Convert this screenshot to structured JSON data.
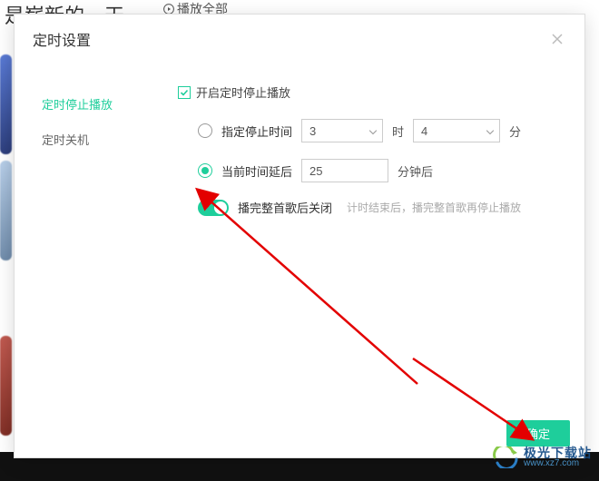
{
  "background": {
    "headline": "是崭新的一天~",
    "play_all": "播放全部"
  },
  "modal": {
    "title": "定时设置",
    "sidebar": {
      "items": [
        {
          "label": "定时停止播放"
        },
        {
          "label": "定时关机"
        }
      ]
    },
    "enable_label": "开启定时停止播放",
    "option_specify": {
      "label": "指定停止时间",
      "hour_value": "3",
      "hour_unit": "时",
      "min_value": "4",
      "min_unit": "分"
    },
    "option_delay": {
      "label": "当前时间延后",
      "value": "25",
      "unit": "分钟后"
    },
    "toggle": {
      "label": "播完整首歌后关闭",
      "hint": "计时结束后，播完整首歌再停止播放"
    },
    "confirm": "确定"
  },
  "watermark": {
    "cn": "极光下载站",
    "url": "www.xz7.com"
  }
}
